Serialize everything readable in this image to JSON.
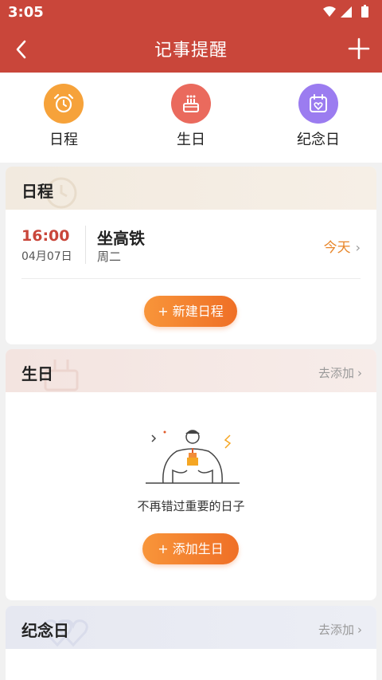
{
  "status": {
    "time": "3:05"
  },
  "nav": {
    "title": "记事提醒"
  },
  "categories": [
    {
      "label": "日程",
      "icon": "alarm-clock-icon",
      "color": "#f6a23a"
    },
    {
      "label": "生日",
      "icon": "birthday-cake-icon",
      "color": "#ea6a5d"
    },
    {
      "label": "纪念日",
      "icon": "calendar-heart-icon",
      "color": "#9b7cf0"
    }
  ],
  "schedule": {
    "title": "日程",
    "event": {
      "time": "16:00",
      "date": "04月07日",
      "name": "坐高铁",
      "weekday": "周二",
      "status": "今天"
    },
    "new_button": "+ 新建日程"
  },
  "birthday": {
    "title": "生日",
    "more": "去添加",
    "empty_text": "不再错过重要的日子",
    "add_button": "+ 添加生日"
  },
  "anniversary": {
    "title": "纪念日",
    "more": "去添加"
  },
  "colors": {
    "brand": "#c9463a",
    "accent": "#ef7a2a"
  }
}
